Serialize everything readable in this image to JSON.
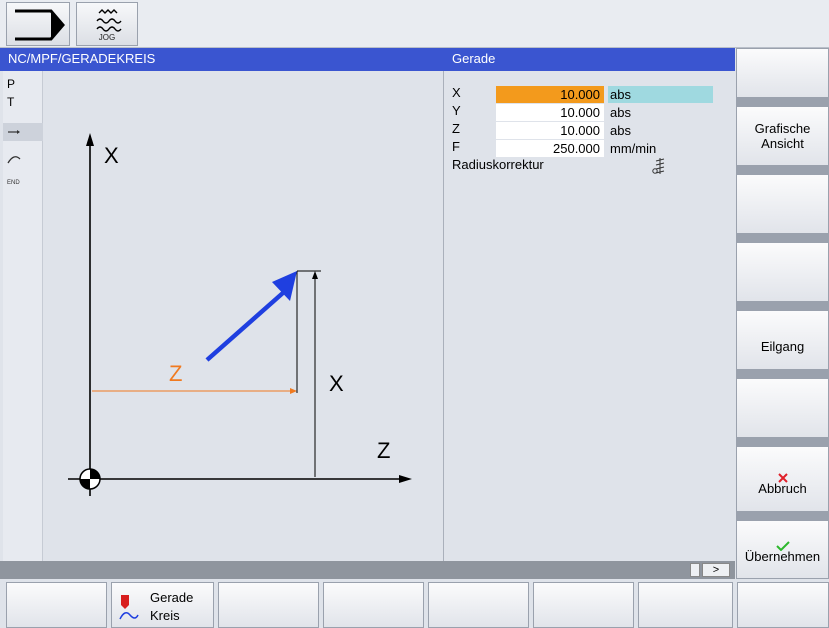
{
  "top_bar": {
    "jog_label": "JOG"
  },
  "title_bar": {
    "path": "NC/MPF/GERADEKREIS",
    "form_title": "Gerade"
  },
  "left_column": {
    "items": [
      "P",
      "T"
    ]
  },
  "diagram": {
    "axis_x_label": "X",
    "axis_z_label": "Z",
    "dim_z_label": "Z",
    "dim_x_label": "X"
  },
  "params": {
    "x": {
      "label": "X",
      "value": "10.000",
      "unit": "abs"
    },
    "y": {
      "label": "Y",
      "value": "10.000",
      "unit": "abs"
    },
    "z": {
      "label": "Z",
      "value": "10.000",
      "unit": "abs"
    },
    "f": {
      "label": "F",
      "value": "250.000",
      "unit": "mm/min"
    },
    "radius_label": "Radiuskorrektur"
  },
  "status_strip": {
    "more_label": ">"
  },
  "softkeys_right": {
    "grafische": "Grafische",
    "ansicht": "Ansicht",
    "eilgang": "Eilgang",
    "abbruch": "Abbruch",
    "uebernehmen": "Übernehmen"
  },
  "softkeys_bottom": {
    "gerade": "Gerade",
    "kreis": "Kreis"
  },
  "colors": {
    "title_bar": "#3a55d0",
    "active_field": "#f39a1c",
    "unit_highlight": "#9fd9e0",
    "arrow": "#1f3fe0",
    "dim_z": "#f07a20"
  }
}
